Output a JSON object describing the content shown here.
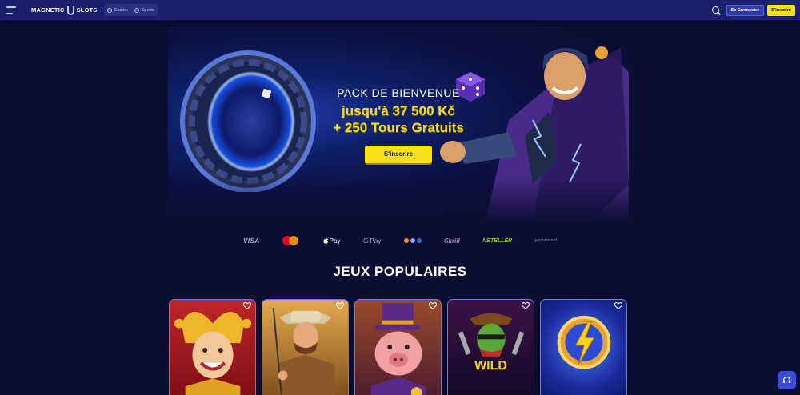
{
  "header": {
    "logo_text_left": "MAGNETIC",
    "logo_text_right": "SLOTS",
    "nav": [
      {
        "label": "Casino",
        "icon": "casino-chip-icon"
      },
      {
        "label": "Sports",
        "icon": "soccer-ball-icon"
      }
    ],
    "login_label": "Se Connecter",
    "signup_label": "S'inscrire"
  },
  "hero": {
    "subtitle": "PACK DE BIENVENUE",
    "line1": "jusqu'à 37 500 Kč",
    "line2": "+ 250 Tours Gratuits",
    "cta_label": "S'inscrire"
  },
  "payments": [
    "VISA",
    "mastercard",
    "Pay",
    "G Pay",
    "crypto",
    "Skrill",
    "NETELLER",
    "paysafecard"
  ],
  "payment_labels": {
    "visa": "VISA",
    "apple": "Pay",
    "gpay": "G Pay",
    "skrill": "Skrill",
    "neteller": "NETELLER",
    "paysafe": "paysafecard"
  },
  "section_title": "JEUX POPULAIRES",
  "games": [
    {
      "theme": "jester"
    },
    {
      "theme": "cowboy-fisherman"
    },
    {
      "theme": "pig-in-top-hat"
    },
    {
      "theme": "cactus-bandit",
      "badge": "WILD"
    },
    {
      "theme": "lightning-coin"
    }
  ],
  "colors": {
    "background": "#0b0d33",
    "header": "#1a1f6e",
    "accent_yellow": "#f6e116",
    "card_border": "#6d78e6"
  }
}
